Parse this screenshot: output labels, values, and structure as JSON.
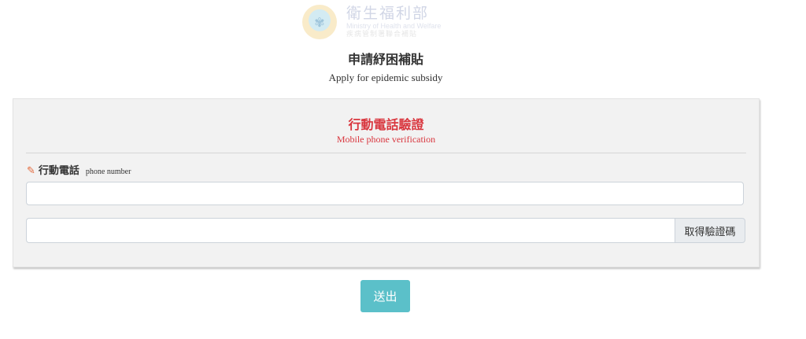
{
  "header": {
    "logo_zh": "衛生福利部",
    "logo_en": "Ministry of Health and Welfare",
    "logo_sub": "疾病管制署聯合補貼",
    "title": "申請紓困補貼",
    "subtitle": "Apply for epidemic subsidy"
  },
  "panel": {
    "title": "行動電話驗證",
    "subtitle": "Mobile phone verification",
    "field_label_zh": "行動電話",
    "field_label_en": "phone number",
    "phone_value": "",
    "code_value": "",
    "get_code_label": "取得驗證碼"
  },
  "actions": {
    "submit_label": "送出"
  },
  "colors": {
    "accent_red": "#d9363e",
    "submit_teal": "#5bc0c9",
    "panel_bg": "#f2f2f2",
    "pencil_orange": "#e4683a"
  },
  "icons": {
    "logo": "ministry-emblem-icon",
    "field": "pencil-icon"
  }
}
